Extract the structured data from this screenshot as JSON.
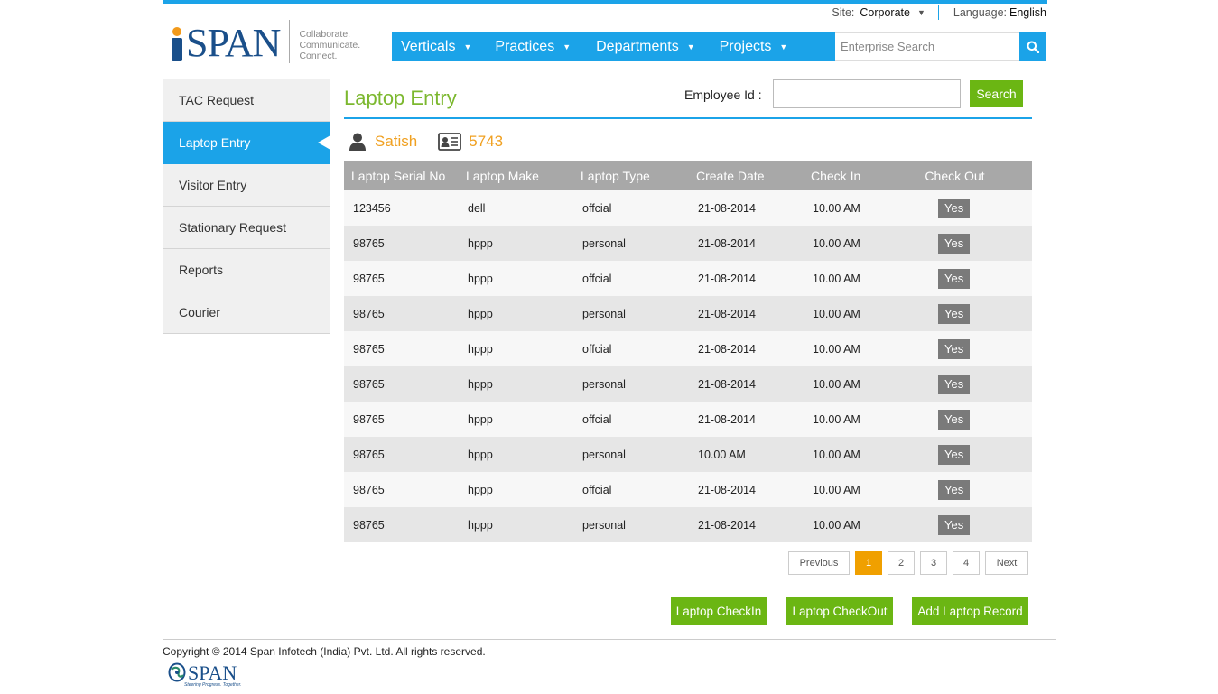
{
  "header": {
    "site_label": "Site:",
    "site_value": "Corporate",
    "language_label": "Language:",
    "language_value": "English",
    "logo_text": "SPAN",
    "tagline": [
      "Collaborate.",
      "Communicate.",
      "Connect."
    ],
    "nav": [
      "Verticals",
      "Practices",
      "Departments",
      "Projects"
    ],
    "search_placeholder": "Enterprise Search"
  },
  "sidebar": {
    "items": [
      "TAC Request",
      "Laptop Entry",
      "Visitor Entry",
      "Stationary Request",
      "Reports",
      "Courier"
    ],
    "active": "Laptop Entry"
  },
  "main": {
    "title": "Laptop Entry",
    "employee_label": "Employee Id :",
    "search_button": "Search",
    "user_name": "Satish",
    "user_id": "5743"
  },
  "table": {
    "columns": [
      "Laptop Serial No",
      "Laptop Make",
      "Laptop Type",
      "Create Date",
      "Check In",
      "Check Out"
    ],
    "rows": [
      [
        "123456",
        "dell",
        "offcial",
        "21-08-2014",
        "10.00 AM",
        "Yes"
      ],
      [
        "98765",
        "hppp",
        "personal",
        "21-08-2014",
        "10.00 AM",
        "Yes"
      ],
      [
        "98765",
        "hppp",
        "offcial",
        "21-08-2014",
        "10.00 AM",
        "Yes"
      ],
      [
        "98765",
        "hppp",
        "personal",
        "21-08-2014",
        "10.00 AM",
        "Yes"
      ],
      [
        "98765",
        "hppp",
        "offcial",
        "21-08-2014",
        "10.00 AM",
        "Yes"
      ],
      [
        "98765",
        "hppp",
        "personal",
        "21-08-2014",
        "10.00 AM",
        "Yes"
      ],
      [
        "98765",
        "hppp",
        "offcial",
        "21-08-2014",
        "10.00 AM",
        "Yes"
      ],
      [
        "98765",
        "hppp",
        "personal",
        "10.00 AM",
        "10.00 AM",
        "Yes"
      ],
      [
        "98765",
        "hppp",
        "offcial",
        "21-08-2014",
        "10.00 AM",
        "Yes"
      ],
      [
        "98765",
        "hppp",
        "personal",
        "21-08-2014",
        "10.00 AM",
        "Yes"
      ]
    ]
  },
  "pagination": {
    "previous": "Previous",
    "pages": [
      "1",
      "2",
      "3",
      "4"
    ],
    "current": "1",
    "next": "Next"
  },
  "actions": {
    "checkin": "Laptop CheckIn",
    "checkout": "Laptop CheckOut",
    "add": "Add Laptop Record"
  },
  "footer": {
    "copyright": "Copyright © 2014 Span Infotech (India) Pvt. Ltd. All rights reserved.",
    "logo_text": "SPAN",
    "logo_tagline": "Steering Progress. Together."
  },
  "colors": {
    "brand_blue": "#1ba3e8",
    "accent_green": "#6bb613",
    "title_green": "#7cb82f",
    "accent_orange": "#f0a020",
    "logo_navy": "#1a4f8a"
  },
  "icons": [
    "chevron-down-icon",
    "search-icon",
    "user-icon",
    "id-card-icon",
    "sidebar-pointer-icon"
  ]
}
